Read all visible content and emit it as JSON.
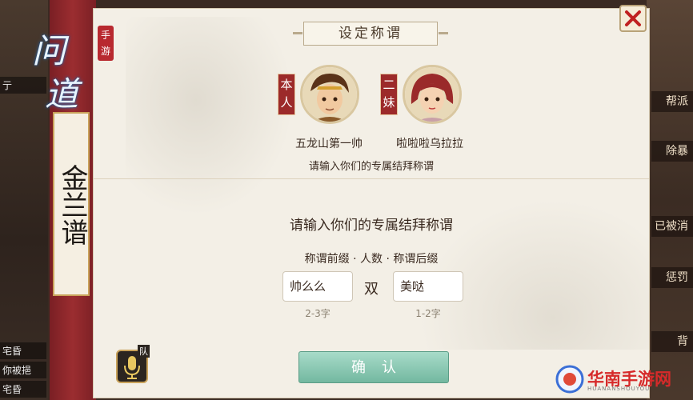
{
  "background": {
    "left_items": [
      "亍",
      "宅昏",
      "你被挹",
      "宅昏"
    ],
    "right_items": [
      "帮派",
      "除暴",
      "已被消",
      "惩罚",
      "背"
    ]
  },
  "logo": {
    "line1": "问",
    "line2": "道",
    "badge": "手游"
  },
  "ribbon": {
    "title": "金兰谱"
  },
  "dialog": {
    "title": "设定称谓",
    "members": [
      {
        "tag": "本人",
        "name": "五龙山第一帅"
      },
      {
        "tag": "二妹",
        "name": "啦啦啦乌拉拉"
      }
    ],
    "hint": "请输入你们的专属结拜称谓",
    "heading": "请输入你们的专属结拜称谓",
    "format": "称谓前缀 · 人数 · 称谓后缀",
    "prefix": {
      "value": "帅么么",
      "limit": "2-3字"
    },
    "middle": "双",
    "suffix": {
      "value": "美哒",
      "limit": "1-2字"
    },
    "confirm_label": "确认",
    "mic_badge": "队"
  },
  "icons": {
    "close": "close-icon",
    "mic": "microphone-icon"
  },
  "watermark": {
    "text": "华南手游网",
    "sub": "HUANANSHOUYOU"
  },
  "colors": {
    "ribbon": "#9b2d30",
    "confirm": "#73b8a0",
    "dialog_bg": "#f3efe6"
  }
}
